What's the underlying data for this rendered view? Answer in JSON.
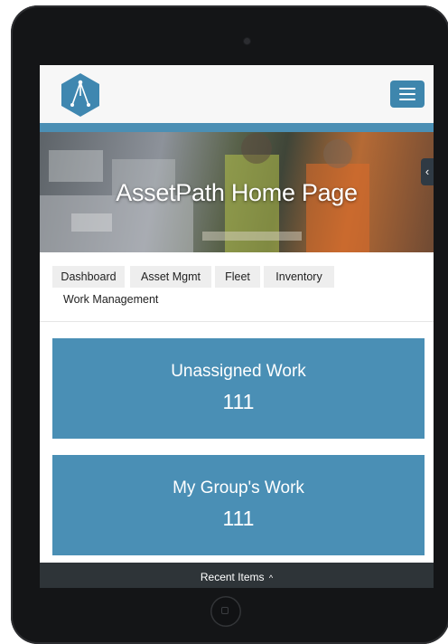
{
  "app": {
    "hero_title": "AssetPath Home Page",
    "menu_icon": "hamburger-menu-icon",
    "side_tab_icon": "chevron-left-icon",
    "logo_icon": "assetpath-logo-icon"
  },
  "tabs": [
    {
      "label": "Dashboard"
    },
    {
      "label": "Asset Mgmt"
    },
    {
      "label": "Fleet"
    },
    {
      "label": "Inventory"
    },
    {
      "label": "Work Management",
      "active": true
    }
  ],
  "tiles": [
    {
      "title": "Unassigned Work",
      "count": "111"
    },
    {
      "title": "My Group's Work",
      "count": "111"
    }
  ],
  "footer": {
    "label": "Recent Items",
    "icon": "caret-up-icon"
  },
  "colors": {
    "accent": "#4a8fb5",
    "menu_button": "#3e86ad",
    "footer": "#2e3438"
  }
}
